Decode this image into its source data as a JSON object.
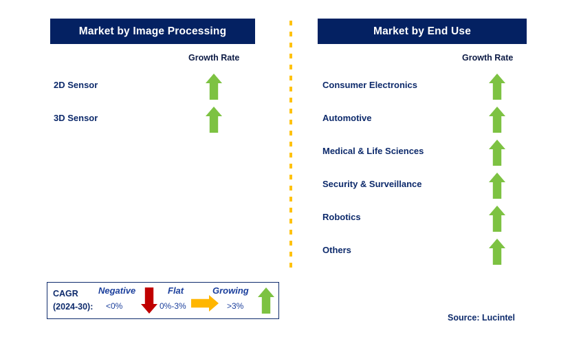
{
  "panels": [
    {
      "id": "image-processing",
      "title": "Market by Image Processing",
      "growth_rate_label": "Growth Rate",
      "rows": [
        {
          "label": "2D Sensor",
          "growth": "up",
          "icon": "green-up-arrow-icon"
        },
        {
          "label": "3D Sensor",
          "growth": "up",
          "icon": "green-up-arrow-icon"
        }
      ]
    },
    {
      "id": "end-use",
      "title": "Market by End Use",
      "growth_rate_label": "Growth Rate",
      "rows": [
        {
          "label": "Consumer Electronics",
          "growth": "up",
          "icon": "green-up-arrow-icon"
        },
        {
          "label": "Automotive",
          "growth": "up",
          "icon": "green-up-arrow-icon"
        },
        {
          "label": "Medical & Life Sciences",
          "growth": "up",
          "icon": "green-up-arrow-icon"
        },
        {
          "label": "Security & Surveillance",
          "growth": "up",
          "icon": "green-up-arrow-icon"
        },
        {
          "label": "Robotics",
          "growth": "up",
          "icon": "green-up-arrow-icon"
        },
        {
          "label": "Others",
          "growth": "up",
          "icon": "green-up-arrow-icon"
        }
      ]
    }
  ],
  "legend": {
    "cagr_line1": "CAGR",
    "cagr_line2": "(2024-30):",
    "items": [
      {
        "title": "Negative",
        "value": "<0%",
        "icon": "red-down-arrow-icon",
        "color": "#C00000"
      },
      {
        "title": "Flat",
        "value": "0%-3%",
        "icon": "orange-right-arrow-icon",
        "color": "#FFB600"
      },
      {
        "title": "Growing",
        "value": ">3%",
        "icon": "green-up-arrow-icon",
        "color": "#7DC242"
      }
    ]
  },
  "source": "Source: Lucintel",
  "colors": {
    "header_bar": "#042162",
    "header_text": "#FFFFFF",
    "label_text": "#0D2A6B",
    "growth_positive": "#7DC242",
    "growth_negative": "#C00000",
    "growth_flat": "#FFB600",
    "divider": "#FFC20E",
    "legend_border": "#0D2A6B"
  }
}
